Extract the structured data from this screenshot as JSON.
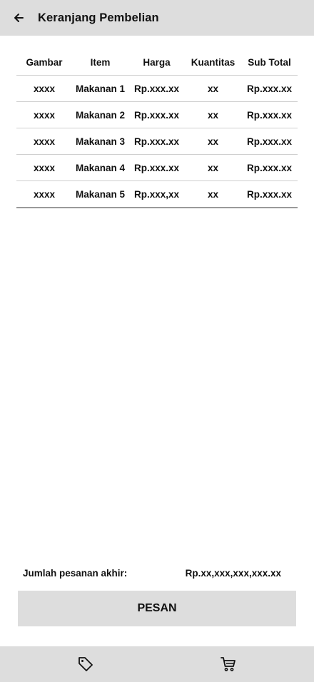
{
  "header": {
    "back_icon": "arrow-left-icon",
    "title": "Keranjang Pembelian"
  },
  "table": {
    "columns": [
      "Gambar",
      "Item",
      "Harga",
      "Kuantitas",
      "Sub Total"
    ],
    "rows": [
      [
        "xxxx",
        "Makanan 1",
        "Rp.xxx.xx",
        "xx",
        "Rp.xxx.xx"
      ],
      [
        "xxxx",
        "Makanan 2",
        "Rp.xxx.xx",
        "xx",
        "Rp.xxx.xx"
      ],
      [
        "xxxx",
        "Makanan 3",
        "Rp.xxx.xx",
        "xx",
        "Rp.xxx.xx"
      ],
      [
        "xxxx",
        "Makanan 4",
        "Rp.xxx.xx",
        "xx",
        "Rp.xxx.xx"
      ],
      [
        "xxxx",
        "Makanan 5",
        "Rp.xxx,xx",
        "xx",
        "Rp.xxx.xx"
      ]
    ]
  },
  "summary": {
    "label": "Jumlah pesanan akhir:",
    "value": "Rp.xx,xxx,xxx,xxx.xx"
  },
  "order_button": {
    "label": "PESAN"
  },
  "bottom_nav": {
    "items": [
      {
        "icon": "tag-icon"
      },
      {
        "icon": "cart-icon"
      }
    ]
  },
  "colors": {
    "bar_background": "#dddddd",
    "text": "#111111",
    "background": "#ffffff"
  }
}
